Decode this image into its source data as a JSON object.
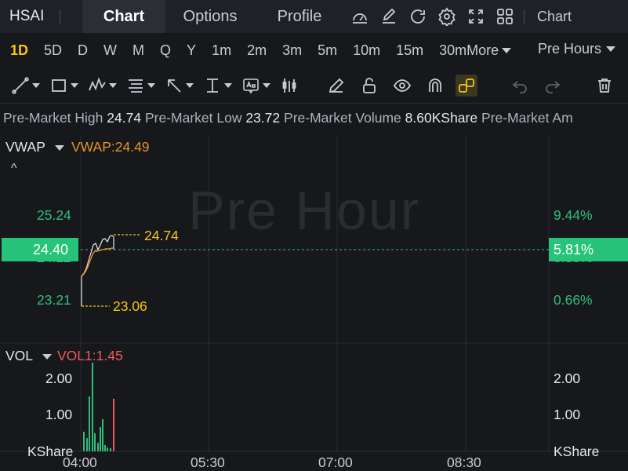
{
  "topnav": {
    "ticker": "HSAI",
    "tabs": [
      "Chart",
      "Options",
      "Profile"
    ],
    "chart_label": "Chart"
  },
  "periods": {
    "items": [
      "1D",
      "5D",
      "D",
      "W",
      "M",
      "Q",
      "Y",
      "1m",
      "2m",
      "3m",
      "5m",
      "10m",
      "15m",
      "30m"
    ],
    "more": "More",
    "session": "Pre Hours"
  },
  "stats": {
    "high_label": "Pre-Market High",
    "high_value": "24.74",
    "low_label": "Pre-Market Low",
    "low_value": "23.72",
    "volume_label": "Pre-Market Volume",
    "volume_value": "8.60KShare",
    "extra": "Pre-Market Am"
  },
  "price_panel": {
    "indicator": "VWAP",
    "indicator_value": "VWAP:24.49",
    "watermark": "Pre Hour",
    "left_ticks": [
      "25.24",
      "24.22",
      "23.21"
    ],
    "right_ticks": [
      "9.44%",
      "3.83%",
      "0.66%"
    ],
    "current_price": "24.40",
    "current_pct": "5.81%",
    "high_marker": "24.74",
    "low_marker": "23.06"
  },
  "volume_panel": {
    "indicator": "VOL",
    "indicator_value": "VOL1:1.45",
    "left_ticks": [
      "2.00",
      "1.00"
    ],
    "right_ticks": [
      "2.00",
      "1.00"
    ],
    "unit": "KShare"
  },
  "time_axis": [
    "04:00",
    "05:30",
    "07:00",
    "08:30"
  ],
  "colors": {
    "up": "#2fbe7a",
    "down": "#f05a5a",
    "accent": "#f5c518",
    "vwap": "#e8932b"
  }
}
